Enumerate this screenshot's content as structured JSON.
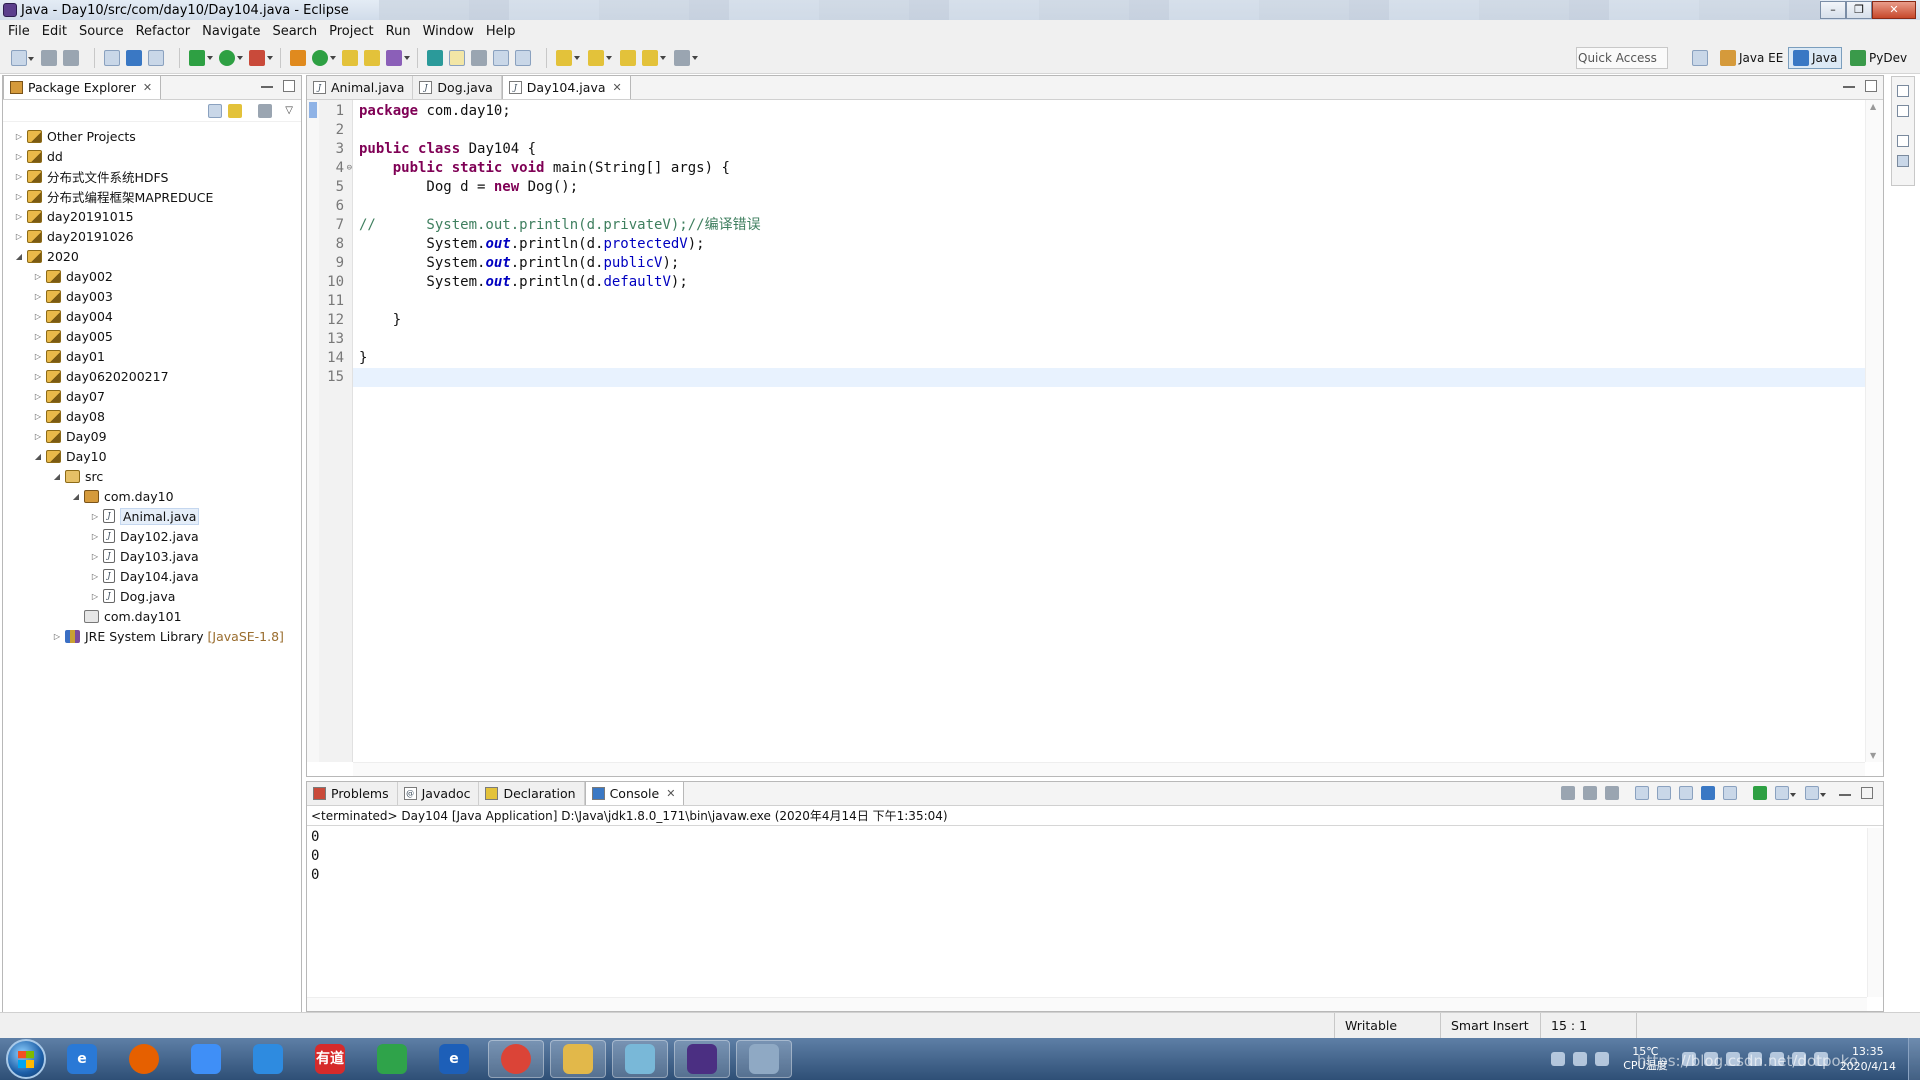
{
  "window": {
    "title": "Java - Day10/src/com/day10/Day104.java - Eclipse"
  },
  "menu": [
    "File",
    "Edit",
    "Source",
    "Refactor",
    "Navigate",
    "Search",
    "Project",
    "Run",
    "Window",
    "Help"
  ],
  "toolbar": {
    "quick_access": "Quick Access",
    "perspectives": [
      {
        "label": "Java EE",
        "active": false
      },
      {
        "label": "Java",
        "active": true
      },
      {
        "label": "PyDev",
        "active": false
      }
    ]
  },
  "explorer": {
    "tab": "Package Explorer",
    "tree": [
      {
        "label": "Other Projects",
        "depth": 0,
        "icon": "project",
        "expanded": false
      },
      {
        "label": "dd",
        "depth": 0,
        "icon": "project",
        "expanded": false
      },
      {
        "label": "分布式文件系统HDFS",
        "depth": 0,
        "icon": "project",
        "expanded": false
      },
      {
        "label": "分布式编程框架MAPREDUCE",
        "depth": 0,
        "icon": "project",
        "expanded": false
      },
      {
        "label": "day20191015",
        "depth": 0,
        "icon": "project",
        "expanded": false
      },
      {
        "label": "day20191026",
        "depth": 0,
        "icon": "project",
        "expanded": false
      },
      {
        "label": "2020",
        "depth": 0,
        "icon": "project",
        "expanded": true
      },
      {
        "label": "day002",
        "depth": 1,
        "icon": "project",
        "expanded": false
      },
      {
        "label": "day003",
        "depth": 1,
        "icon": "project",
        "expanded": false
      },
      {
        "label": "day004",
        "depth": 1,
        "icon": "project",
        "expanded": false
      },
      {
        "label": "day005",
        "depth": 1,
        "icon": "project",
        "expanded": false
      },
      {
        "label": "day01",
        "depth": 1,
        "icon": "project",
        "expanded": false
      },
      {
        "label": "day0620200217",
        "depth": 1,
        "icon": "project",
        "expanded": false
      },
      {
        "label": "day07",
        "depth": 1,
        "icon": "project",
        "expanded": false
      },
      {
        "label": "day08",
        "depth": 1,
        "icon": "project",
        "expanded": false
      },
      {
        "label": "Day09",
        "depth": 1,
        "icon": "project",
        "expanded": false
      },
      {
        "label": "Day10",
        "depth": 1,
        "icon": "project",
        "expanded": true
      },
      {
        "label": "src",
        "depth": 2,
        "icon": "src",
        "expanded": true
      },
      {
        "label": "com.day10",
        "depth": 3,
        "icon": "package",
        "expanded": true
      },
      {
        "label": "Animal.java",
        "depth": 4,
        "icon": "java",
        "expanded": false,
        "selected": true
      },
      {
        "label": "Day102.java",
        "depth": 4,
        "icon": "java",
        "expanded": false
      },
      {
        "label": "Day103.java",
        "depth": 4,
        "icon": "java",
        "expanded": false
      },
      {
        "label": "Day104.java",
        "depth": 4,
        "icon": "java",
        "expanded": false
      },
      {
        "label": "Dog.java",
        "depth": 4,
        "icon": "java",
        "expanded": false
      },
      {
        "label": "com.day101",
        "depth": 3,
        "icon": "package-empty",
        "leaf": true
      },
      {
        "label": "JRE System Library",
        "decoration": "[JavaSE-1.8]",
        "depth": 2,
        "icon": "library",
        "expanded": false
      }
    ]
  },
  "editor": {
    "tabs": [
      {
        "label": "Animal.java",
        "active": false
      },
      {
        "label": "Dog.java",
        "active": false
      },
      {
        "label": "Day104.java",
        "active": true
      }
    ],
    "lines": [
      [
        [
          "kw",
          "package"
        ],
        [
          "t",
          " com.day10;"
        ]
      ],
      [],
      [
        [
          "kw",
          "public"
        ],
        [
          "t",
          " "
        ],
        [
          "kw",
          "class"
        ],
        [
          "t",
          " Day104 {"
        ]
      ],
      [
        [
          "t",
          "    "
        ],
        [
          "kw",
          "public"
        ],
        [
          "t",
          " "
        ],
        [
          "kw",
          "static"
        ],
        [
          "t",
          " "
        ],
        [
          "kw",
          "void"
        ],
        [
          "t",
          " main(String[] args) {"
        ]
      ],
      [
        [
          "t",
          "        Dog d = "
        ],
        [
          "kw",
          "new"
        ],
        [
          "t",
          " Dog();"
        ]
      ],
      [],
      [
        [
          "cm",
          "//      System.out.println(d.privateV);//编译错误"
        ]
      ],
      [
        [
          "t",
          "        System."
        ],
        [
          "sf",
          "out"
        ],
        [
          "t",
          ".println(d."
        ],
        [
          "fld",
          "protectedV"
        ],
        [
          "t",
          ");"
        ]
      ],
      [
        [
          "t",
          "        System."
        ],
        [
          "sf",
          "out"
        ],
        [
          "t",
          ".println(d."
        ],
        [
          "fld",
          "publicV"
        ],
        [
          "t",
          ");"
        ]
      ],
      [
        [
          "t",
          "        System."
        ],
        [
          "sf",
          "out"
        ],
        [
          "t",
          ".println(d."
        ],
        [
          "fld",
          "defaultV"
        ],
        [
          "t",
          ");"
        ]
      ],
      [],
      [
        [
          "t",
          "    }"
        ]
      ],
      [],
      [
        [
          "t",
          "}"
        ]
      ],
      []
    ],
    "current_line": 15
  },
  "console": {
    "tabs": [
      {
        "label": "Problems",
        "active": false
      },
      {
        "label": "Javadoc",
        "active": false
      },
      {
        "label": "Declaration",
        "active": false
      },
      {
        "label": "Console",
        "active": true
      }
    ],
    "info": "<terminated> Day104 [Java Application] D:\\Java\\jdk1.8.0_171\\bin\\javaw.exe (2020年4月14日 下午1:35:04)",
    "output": [
      "0",
      "0",
      "0"
    ]
  },
  "status": {
    "writable": "Writable",
    "insert_mode": "Smart Insert",
    "position": "15 : 1"
  },
  "taskbar": {
    "apps": [
      {
        "name": "ie",
        "color": "#2a79d6",
        "glyph": "e",
        "active": false
      },
      {
        "name": "firefox",
        "color": "#e66000",
        "glyph": "",
        "active": false
      },
      {
        "name": "baidu-netdisk",
        "color": "#3f8ff7",
        "glyph": "",
        "active": false
      },
      {
        "name": "cloud",
        "color": "#2e8be0",
        "glyph": "",
        "active": false
      },
      {
        "name": "youdao",
        "color": "#d62b2b",
        "glyph": "有道",
        "active": false
      },
      {
        "name": "sync",
        "color": "#2fa34a",
        "glyph": "",
        "active": false
      },
      {
        "name": "ie-2",
        "color": "#1d5fb8",
        "glyph": "e",
        "active": false
      },
      {
        "name": "chrome",
        "color": "#db4437",
        "glyph": "",
        "active": true
      },
      {
        "name": "explorer",
        "color": "#e2b84a",
        "glyph": "",
        "active": true
      },
      {
        "name": "notepad",
        "color": "#79b8d8",
        "glyph": "",
        "active": true
      },
      {
        "name": "eclipse",
        "color": "#4b2f82",
        "glyph": "",
        "active": true
      },
      {
        "name": "calculator",
        "color": "#8fa9c4",
        "glyph": "",
        "active": true
      }
    ],
    "temperature": "15℃",
    "temp_label": "CPU温度",
    "time": "13:35",
    "date": "2020/4/14",
    "watermark": "https://blog.csdn.net/dotpoko"
  }
}
